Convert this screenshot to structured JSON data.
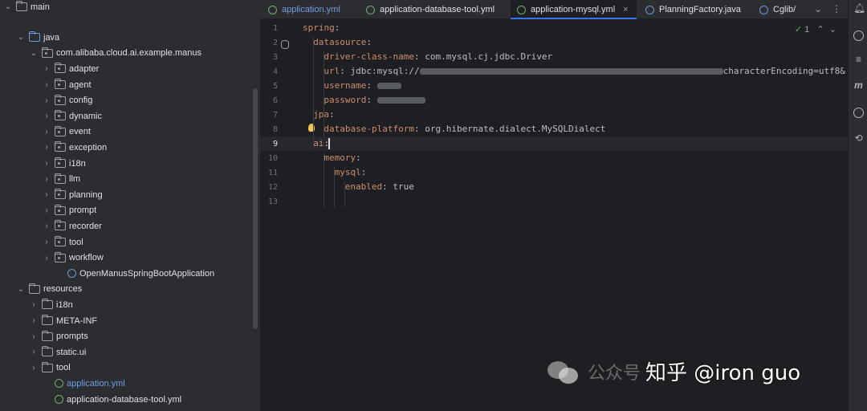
{
  "tree": {
    "rows": [
      {
        "label": "main",
        "depth": 0,
        "chevron": "open",
        "icon": "folder-icon"
      },
      {
        "label": "java",
        "depth": 1,
        "chevron": "open",
        "icon": "source-folder-icon"
      },
      {
        "label": "com.alibaba.cloud.ai.example.manus",
        "depth": 2,
        "chevron": "open",
        "icon": "package-icon"
      },
      {
        "label": "adapter",
        "depth": 3,
        "chevron": "closed",
        "icon": "package-icon"
      },
      {
        "label": "agent",
        "depth": 3,
        "chevron": "closed",
        "icon": "package-icon"
      },
      {
        "label": "config",
        "depth": 3,
        "chevron": "closed",
        "icon": "package-icon"
      },
      {
        "label": "dynamic",
        "depth": 3,
        "chevron": "closed",
        "icon": "package-icon"
      },
      {
        "label": "event",
        "depth": 3,
        "chevron": "closed",
        "icon": "package-icon"
      },
      {
        "label": "exception",
        "depth": 3,
        "chevron": "closed",
        "icon": "package-icon"
      },
      {
        "label": "i18n",
        "depth": 3,
        "chevron": "closed",
        "icon": "package-icon"
      },
      {
        "label": "llm",
        "depth": 3,
        "chevron": "closed",
        "icon": "package-icon"
      },
      {
        "label": "planning",
        "depth": 3,
        "chevron": "closed",
        "icon": "package-icon"
      },
      {
        "label": "prompt",
        "depth": 3,
        "chevron": "closed",
        "icon": "package-icon"
      },
      {
        "label": "recorder",
        "depth": 3,
        "chevron": "closed",
        "icon": "package-icon"
      },
      {
        "label": "tool",
        "depth": 3,
        "chevron": "closed",
        "icon": "package-icon"
      },
      {
        "label": "workflow",
        "depth": 3,
        "chevron": "closed",
        "icon": "package-icon"
      },
      {
        "label": "OpenManusSpringBootApplication",
        "depth": 4,
        "chevron": "none",
        "icon": "class-icon"
      },
      {
        "label": "resources",
        "depth": 1,
        "chevron": "open",
        "icon": "resources-folder-icon"
      },
      {
        "label": "i18n",
        "depth": 2,
        "chevron": "closed",
        "icon": "folder-icon"
      },
      {
        "label": "META-INF",
        "depth": 2,
        "chevron": "closed",
        "icon": "folder-icon"
      },
      {
        "label": "prompts",
        "depth": 2,
        "chevron": "closed",
        "icon": "folder-icon"
      },
      {
        "label": "static.ui",
        "depth": 2,
        "chevron": "closed",
        "icon": "folder-icon"
      },
      {
        "label": "tool",
        "depth": 2,
        "chevron": "closed",
        "icon": "folder-icon"
      },
      {
        "label": "application.yml",
        "depth": 3,
        "chevron": "none",
        "icon": "yaml-icon",
        "highlight": true
      },
      {
        "label": "application-database-tool.yml",
        "depth": 3,
        "chevron": "none",
        "icon": "yaml-icon"
      }
    ]
  },
  "tabs": [
    {
      "label": "application.yml",
      "icon": "yaml-icon",
      "color": "#6f9fe6"
    },
    {
      "label": "application-database-tool.yml",
      "icon": "yaml-icon"
    },
    {
      "label": "application-mysql.yml",
      "icon": "yaml-icon",
      "active": true,
      "close": "×"
    },
    {
      "label": "PlanningFactory.java",
      "icon": "class-icon"
    },
    {
      "label": "Cglib/",
      "icon": "class-icon"
    }
  ],
  "tab_more": "⌄",
  "inspection": {
    "check": "✓",
    "count": "1",
    "up": "⌃",
    "down": "⌄"
  },
  "code": {
    "lines": [
      {
        "n": "1",
        "indent": 0,
        "key": "spring",
        "sep": ":",
        "value": ""
      },
      {
        "n": "2",
        "indent": 1,
        "key": "datasource",
        "sep": ":",
        "value": ""
      },
      {
        "n": "3",
        "indent": 2,
        "key": "driver-class-name",
        "sep": ": ",
        "value": "com.mysql.cj.jdbc.Driver"
      },
      {
        "n": "4",
        "indent": 2,
        "key": "url",
        "sep": ": ",
        "value": "jdbc:mysql://",
        "tail": "characterEncoding=utf8&"
      },
      {
        "n": "5",
        "indent": 2,
        "key": "username",
        "sep": ": ",
        "value": ""
      },
      {
        "n": "6",
        "indent": 2,
        "key": "password",
        "sep": ": ",
        "value": ""
      },
      {
        "n": "7",
        "indent": 1,
        "key": "jpa",
        "sep": ":",
        "value": ""
      },
      {
        "n": "8",
        "indent": 2,
        "key": "database-platform",
        "sep": ": ",
        "value": "org.hibernate.dialect.MySQLDialect"
      },
      {
        "n": "9",
        "indent": 1,
        "key": "ai",
        "sep": ":",
        "value": ""
      },
      {
        "n": "10",
        "indent": 2,
        "key": "memory",
        "sep": ":",
        "value": ""
      },
      {
        "n": "11",
        "indent": 3,
        "key": "mysql",
        "sep": ":",
        "value": ""
      },
      {
        "n": "12",
        "indent": 4,
        "key": "enabled",
        "sep": ": ",
        "value": "true"
      },
      {
        "n": "13",
        "indent": 0,
        "key": "",
        "sep": "",
        "value": ""
      }
    ]
  },
  "strip_icons": [
    "bell-icon",
    "ai-assistant-icon",
    "database-icon",
    "maven-icon",
    "gradle-icon",
    "notification-icon"
  ],
  "watermark": {
    "sub": "公众号",
    "main": "知乎 @iron guo"
  },
  "colors": {
    "key": "#cf8e6d",
    "value": "#bcbec4",
    "accent": "#3574f0",
    "yaml": "#6fb069"
  }
}
